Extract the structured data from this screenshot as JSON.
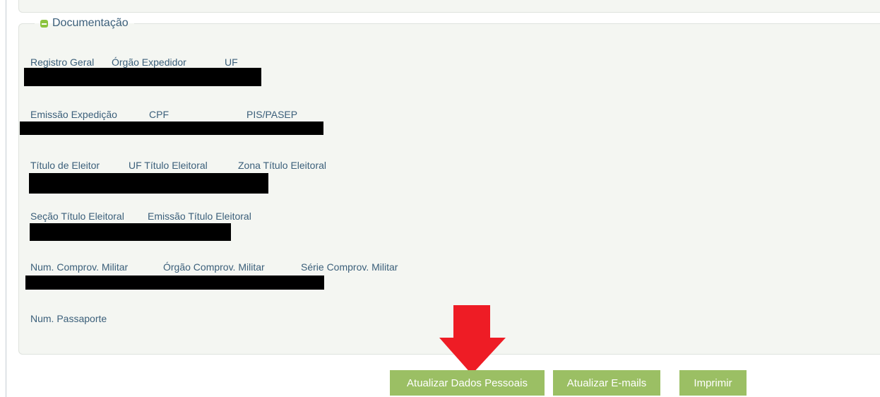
{
  "section": {
    "title": "Documentação"
  },
  "rows": [
    {
      "labels": [
        "Registro Geral",
        "Órgão Expedidor",
        "UF"
      ]
    },
    {
      "labels": [
        "Emissão Expedição",
        "CPF",
        "PIS/PASEP"
      ]
    },
    {
      "labels": [
        "Título de Eleitor",
        "UF Título Eleitoral",
        "Zona Título Eleitoral"
      ]
    },
    {
      "labels": [
        "Seção Título Eleitoral",
        "Emissão Título Eleitoral"
      ]
    },
    {
      "labels": [
        "Num. Comprov. Militar",
        "Órgão Comprov. Militar",
        "Série Comprov. Militar"
      ]
    },
    {
      "labels": [
        "Num. Passaporte"
      ]
    }
  ],
  "buttons": {
    "update_personal": "Atualizar Dados Pessoais",
    "update_emails": "Atualizar E-mails",
    "print": "Imprimir"
  },
  "colors": {
    "accent": "#9bbf64",
    "label_text": "#3b5f7a",
    "panel_bg": "#f4f6f2",
    "arrow": "#ee1c25"
  }
}
